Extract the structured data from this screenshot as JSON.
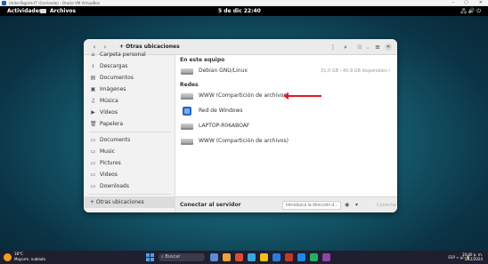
{
  "host_window": {
    "title": "UnitsnTegrels-IT (Corriendo) - Oracle VM VirtualBox",
    "controls": [
      "–",
      "▢",
      "✕"
    ]
  },
  "gnome_topbar": {
    "activities": "Actividades",
    "app_name": "Archivos",
    "clock": "5 de dic 22:40",
    "system_icons": "🖧 🔊 ⏻"
  },
  "nautilus": {
    "path_label": "Otras ubicaciones",
    "sidebar": {
      "top_cut": "Carpeta personal",
      "items": [
        {
          "icon": "download-icon",
          "glyph": "⭳",
          "label": "Descargas"
        },
        {
          "icon": "document-icon",
          "glyph": "▤",
          "label": "Documentos"
        },
        {
          "icon": "image-icon",
          "glyph": "▣",
          "label": "Imágenes"
        },
        {
          "icon": "music-icon",
          "glyph": "♫",
          "label": "Música"
        },
        {
          "icon": "video-icon",
          "glyph": "▶",
          "label": "Vídeos"
        },
        {
          "icon": "trash-icon",
          "glyph": "🗑",
          "label": "Papelera"
        }
      ],
      "bookmarks": [
        {
          "icon": "folder-icon",
          "glyph": "▭",
          "label": "Documents"
        },
        {
          "icon": "folder-icon",
          "glyph": "▭",
          "label": "Music"
        },
        {
          "icon": "folder-icon",
          "glyph": "▭",
          "label": "Pictures"
        },
        {
          "icon": "folder-icon",
          "glyph": "▭",
          "label": "Videos"
        },
        {
          "icon": "folder-icon",
          "glyph": "▭",
          "label": "Downloads"
        }
      ],
      "other_locations": "+ Otras ubicaciones"
    },
    "sections": {
      "on_this_computer": "En este equipo",
      "networks": "Redes"
    },
    "computer_items": [
      {
        "name": "Debian GNU/Linux",
        "info": "31,0 GB / 40,9 GB disponibles   /"
      }
    ],
    "network_items": [
      {
        "name": "WWW (Compartición de archivos)",
        "icon": "network-drive-icon"
      },
      {
        "name": "Red de Windows",
        "icon": "windows-network-icon"
      },
      {
        "name": "LAPTOP-R06ABOAF",
        "icon": "network-drive-icon"
      },
      {
        "name": "WWW (Compartición de archivos)",
        "icon": "network-drive-icon"
      }
    ],
    "connect_label": "Conectar al servidor",
    "server_placeholder": "Introduzca la dirección d...",
    "connect_button": "Conectar"
  },
  "taskbar": {
    "weather_temp": "18°C",
    "weather_desc": "Mayorm. nublado",
    "search_label": "Buscar",
    "tray_text": "ESP  ≈ 🔊 🔋",
    "time": "10:40 p. m.",
    "date": "5/12/2024"
  }
}
